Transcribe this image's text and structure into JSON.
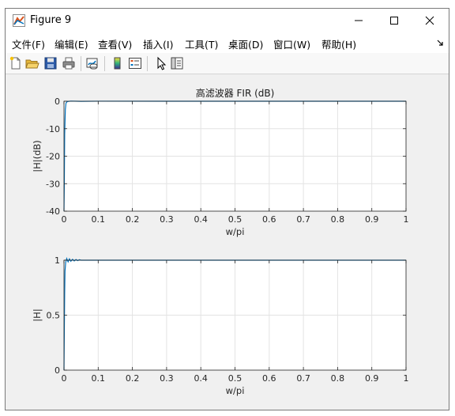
{
  "window": {
    "title": "Figure 9",
    "icon": "matlab-figure-icon",
    "controls": [
      "minimize-icon",
      "maximize-icon",
      "close-icon"
    ]
  },
  "menubar": {
    "items": [
      "文件(F)",
      "编辑(E)",
      "查看(V)",
      "插入(I)",
      "工具(T)",
      "桌面(D)",
      "窗口(W)",
      "帮助(H)"
    ]
  },
  "toolbar": {
    "buttons": [
      "new-figure-icon",
      "open-file-icon",
      "save-icon",
      "print-icon",
      "link-plot-icon",
      "insert-colorbar-icon",
      "insert-legend-icon",
      "edit-plot-icon",
      "property-inspector-icon"
    ]
  },
  "colors": {
    "line": "#0072bd",
    "grid": "#e3e3e3",
    "axis": "#262626",
    "background": "#f0f0f0"
  },
  "chart_data": [
    {
      "type": "line",
      "title": "高滤波器 FIR (dB)",
      "xlabel": "w/pi",
      "ylabel": "|H|(dB)",
      "xlim": [
        0,
        1
      ],
      "ylim": [
        -40,
        0
      ],
      "xticks": [
        0,
        0.1,
        0.2,
        0.3,
        0.4,
        0.5,
        0.6,
        0.7,
        0.8,
        0.9,
        1
      ],
      "xtick_labels": [
        "0",
        "0.1",
        "0.2",
        "0.3",
        "0.4",
        "0.5",
        "0.6",
        "0.7",
        "0.8",
        "0.9",
        "1"
      ],
      "yticks": [
        -40,
        -30,
        -20,
        -10,
        0
      ],
      "ytick_labels": [
        "-40",
        "-30",
        "-20",
        "-10",
        "0"
      ],
      "grid": true,
      "series": [
        {
          "x": [
            0,
            0.001,
            0.002,
            0.004,
            0.006,
            0.01,
            0.02,
            0.05,
            0.1,
            0.3,
            0.5,
            0.7,
            0.9,
            1.0
          ],
          "y": [
            -40,
            -30,
            -12,
            -3,
            -0.6,
            -0.1,
            0.05,
            -0.03,
            0.02,
            0.0,
            0.0,
            0.0,
            0.0,
            0.0
          ]
        }
      ]
    },
    {
      "type": "line",
      "title": "",
      "xlabel": "w/pi",
      "ylabel": "|H|",
      "xlim": [
        0,
        1
      ],
      "ylim": [
        0,
        1
      ],
      "xticks": [
        0,
        0.1,
        0.2,
        0.3,
        0.4,
        0.5,
        0.6,
        0.7,
        0.8,
        0.9,
        1
      ],
      "xtick_labels": [
        "0",
        "0.1",
        "0.2",
        "0.3",
        "0.4",
        "0.5",
        "0.6",
        "0.7",
        "0.8",
        "0.9",
        "1"
      ],
      "yticks": [
        0,
        0.5,
        1
      ],
      "ytick_labels": [
        "0",
        "0.5",
        "1"
      ],
      "grid": true,
      "series": [
        {
          "x": [
            0,
            0.001,
            0.002,
            0.003,
            0.005,
            0.008,
            0.012,
            0.016,
            0.02,
            0.025,
            0.03,
            0.035,
            0.04,
            0.045,
            0.05,
            0.1,
            0.3,
            0.5,
            0.7,
            0.9,
            1.0
          ],
          "y": [
            0.0,
            0.35,
            0.7,
            0.9,
            0.98,
            1.015,
            0.985,
            1.012,
            0.99,
            1.008,
            0.993,
            1.006,
            0.996,
            1.004,
            1.0,
            1.0,
            1.0,
            1.0,
            1.0,
            1.0,
            1.0
          ]
        }
      ]
    }
  ]
}
